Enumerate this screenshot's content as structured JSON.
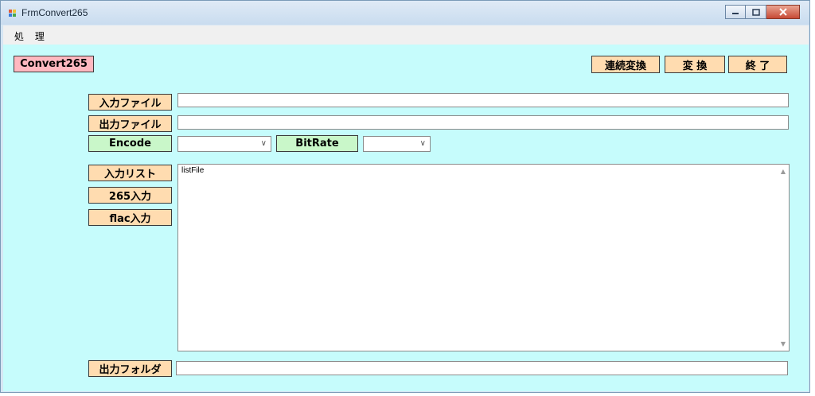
{
  "window": {
    "title": "FrmConvert265"
  },
  "menu": {
    "items": [
      "処 理"
    ]
  },
  "toolbar": {
    "app_label": "Convert265",
    "batch_convert": "連続変換",
    "convert": "変 換",
    "exit": "終 了"
  },
  "form": {
    "input_file_label": "入力ファイル",
    "input_file_value": "",
    "output_file_label": "出力ファイル",
    "output_file_value": "",
    "encode_label": "Encode",
    "encode_selected": "",
    "bitrate_label": "BitRate",
    "bitrate_selected": "",
    "input_list_label": "入力リスト",
    "add_265_label": "265入力",
    "add_flac_label": "flac入力",
    "list_items": [
      "listFile"
    ],
    "output_folder_label": "出力フォルダ",
    "output_folder_value": ""
  },
  "colors": {
    "client_bg": "#c6fcfc",
    "label_peach": "#ffdcb0",
    "label_green": "#c9f7c9",
    "label_pink": "#ffb8c0"
  }
}
